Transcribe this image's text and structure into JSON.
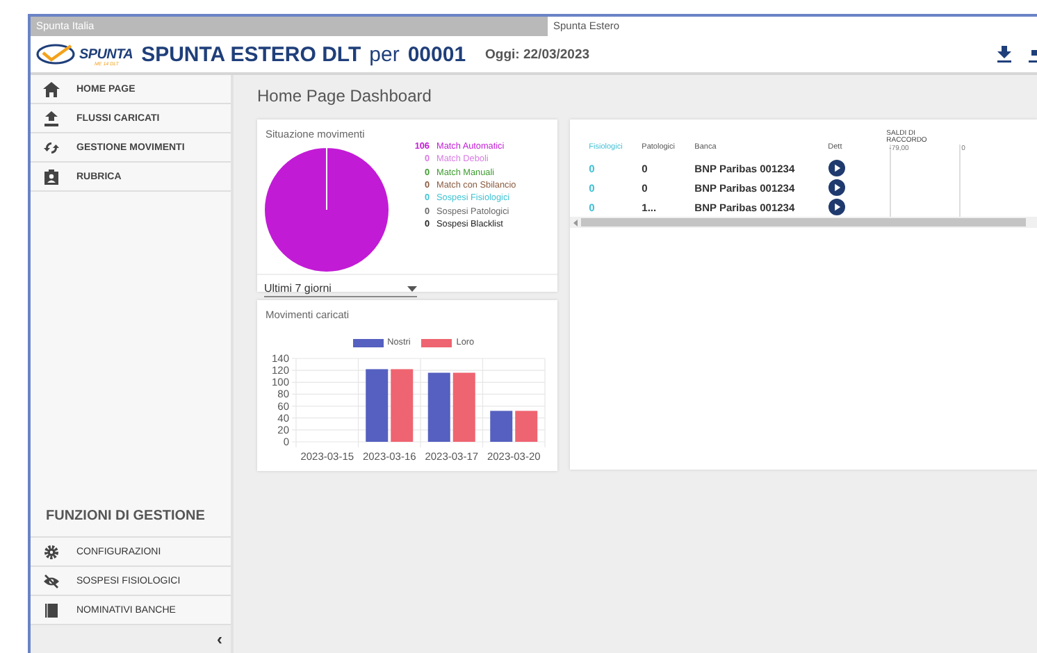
{
  "tabs": [
    {
      "label": "Spunta Italia",
      "selected": false
    },
    {
      "label": "Spunta Estero",
      "selected": true
    }
  ],
  "header": {
    "logo_text": "SPUNTA",
    "logo_subtext": "ME 14 DLT",
    "title": "SPUNTA ESTERO DLT",
    "per": "per",
    "code": "00001",
    "date": "Oggi: 22/03/2023"
  },
  "sidebar": {
    "items": [
      {
        "label": "HOME PAGE"
      },
      {
        "label": "FLUSSI CARICATI"
      },
      {
        "label": "GESTIONE MOVIMENTI"
      },
      {
        "label": "RUBRICA"
      }
    ],
    "section_title": "FUNZIONI DI GESTIONE",
    "section_items": [
      {
        "label": "CONFIGURAZIONI"
      },
      {
        "label": "SOSPESI FISIOLOGICI"
      },
      {
        "label": "NOMINATIVI BANCHE"
      }
    ],
    "collapse": "‹"
  },
  "page_title": "Home Page Dashboard",
  "situazione": {
    "title": "Situazione movimenti",
    "legend": [
      {
        "count": "106",
        "color": "#c21bd6"
      },
      {
        "count": "0",
        "color": "#d77be3"
      },
      {
        "count": "0",
        "color": "#3d9a2f"
      },
      {
        "count": "0",
        "color": "#8a5a3e"
      },
      {
        "count": "0",
        "color": "#3fc3d3"
      },
      {
        "count": "0",
        "color": "#666666"
      },
      {
        "count": "0",
        "color": "#222222"
      }
    ],
    "chart_data": {
      "type": "pie",
      "categories": [
        "Match Automatici",
        "Match Deboli",
        "Match Manuali",
        "Match con Sbilancio",
        "Sospesi Fisiologici",
        "Sospesi Patologici",
        "Sospesi Blacklist"
      ],
      "values": [
        100,
        0,
        0,
        0,
        0,
        0,
        0
      ]
    },
    "period": "Ultimi 7 giorni"
  },
  "movimenti": {
    "title": "Movimenti caricati",
    "chart_data": {
      "type": "bar",
      "categories": [
        "2023-03-15",
        "2023-03-16",
        "2023-03-17",
        "2023-03-20"
      ],
      "series": [
        {
          "name": "Nostri",
          "color": "#5560c0",
          "values": [
            0,
            122,
            116,
            52
          ]
        },
        {
          "name": "Loro",
          "color": "#ee6470",
          "values": [
            0,
            122,
            116,
            52
          ]
        }
      ],
      "ylim": [
        0,
        140
      ],
      "yticks": [
        0,
        20,
        40,
        60,
        80,
        100,
        120,
        140
      ],
      "grid": true
    }
  },
  "table": {
    "columns": [
      "Fisiologici",
      "Patologici",
      "Banca",
      "Dett"
    ],
    "saldi_header": "SALDI DI RACCORDO",
    "saldi_ticks": [
      "-79,00",
      "0"
    ],
    "rows": [
      {
        "fisiologici": "0",
        "patologici": "0",
        "banca": "BNP Paribas 001234"
      },
      {
        "fisiologici": "0",
        "patologici": "0",
        "banca": "BNP Paribas 001234"
      },
      {
        "fisiologici": "0",
        "patologici": "1...",
        "banca": "BNP Paribas 001234"
      }
    ]
  }
}
